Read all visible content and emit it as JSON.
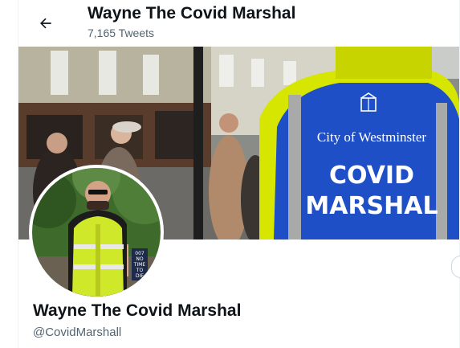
{
  "header": {
    "title": "Wayne The Covid Marshal",
    "tweet_count": "7,165 Tweets",
    "back_icon": "arrow-left-icon"
  },
  "banner": {
    "vest_org_text": "City of Westminster",
    "vest_line1": "COVID",
    "vest_line2": "MARSHAL",
    "colors": {
      "vest_blue": "#1f4fc6",
      "hi_vis": "#d7e600"
    }
  },
  "avatar": {
    "sign_text": [
      "007",
      "NO",
      "TIME",
      "TO",
      "DIE"
    ]
  },
  "profile": {
    "display_name": "Wayne The Covid Marshal",
    "handle": "@CovidMarshall"
  }
}
